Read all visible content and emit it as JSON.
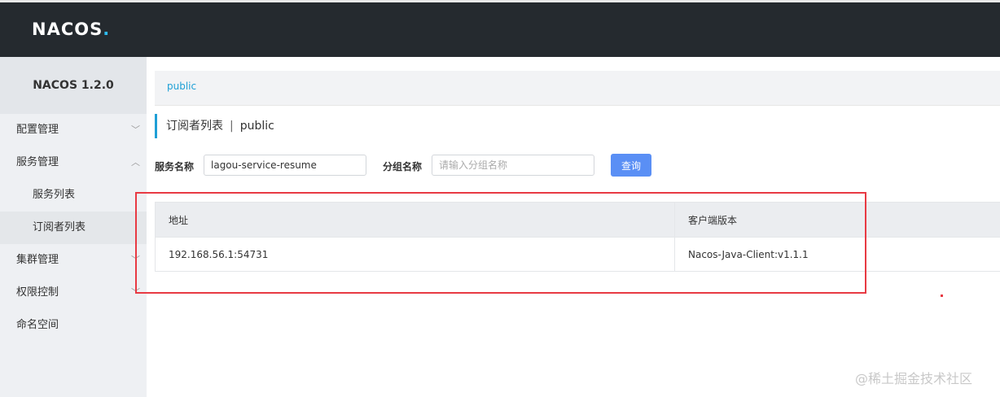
{
  "header": {
    "logo_main": "NACOS",
    "logo_dot": "."
  },
  "sidebar": {
    "version": "NACOS 1.2.0",
    "items": [
      {
        "label": "配置管理",
        "chevron": "chevron-down"
      },
      {
        "label": "服务管理",
        "chevron": "chevron-up"
      },
      {
        "label": "服务列表"
      },
      {
        "label": "订阅者列表",
        "active": true
      },
      {
        "label": "集群管理",
        "chevron": "chevron-down"
      },
      {
        "label": "权限控制",
        "chevron": "chevron-down"
      },
      {
        "label": "命名空间"
      }
    ]
  },
  "namespace": {
    "tag": "public"
  },
  "page": {
    "title": "订阅者列表",
    "separator": "|",
    "namespace": "public"
  },
  "form": {
    "service_label": "服务名称",
    "service_value": "lagou-service-resume",
    "group_label": "分组名称",
    "group_placeholder": "请输入分组名称",
    "query_label": "查询"
  },
  "table": {
    "columns": [
      "地址",
      "客户端版本"
    ],
    "rows": [
      [
        "192.168.56.1:54731",
        "Nacos-Java-Client:v1.1.1"
      ]
    ]
  },
  "colors": {
    "accent": "#1f9fd6",
    "primary_button": "#5a8ff5",
    "highlight_box": "#e83a43",
    "header_bg": "#252a2f"
  },
  "watermark": "@稀土掘金技术社区"
}
